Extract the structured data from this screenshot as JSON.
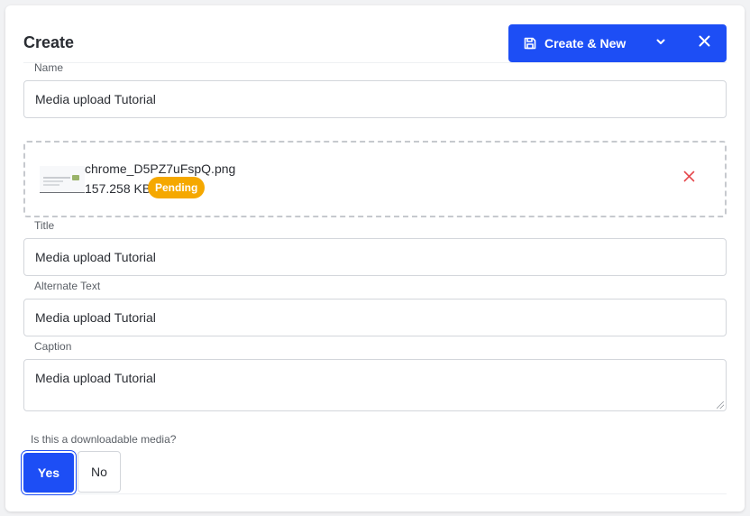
{
  "header": {
    "title": "Create",
    "create_new_label": "Create & New"
  },
  "form": {
    "name": {
      "label": "Name",
      "value": "Media upload Tutorial"
    },
    "upload": {
      "file_name": "chrome_D5PZ7uFspQ.png",
      "file_size": "157.258 KB",
      "status": "Pending"
    },
    "title": {
      "label": "Title",
      "value": "Media upload Tutorial"
    },
    "alt_text": {
      "label": "Alternate Text",
      "value": "Media upload Tutorial"
    },
    "caption": {
      "label": "Caption",
      "value": "Media upload Tutorial"
    },
    "downloadable": {
      "question": "Is this a downloadable media?",
      "yes_label": "Yes",
      "no_label": "No",
      "selected": "Yes"
    }
  },
  "colors": {
    "primary": "#1d4ef5",
    "pending_badge": "#f5a800",
    "remove_icon": "#e5484d"
  },
  "icons": {
    "save": "save-icon",
    "caret": "chevron-down-icon",
    "close": "close-icon",
    "remove": "remove-file-icon"
  }
}
